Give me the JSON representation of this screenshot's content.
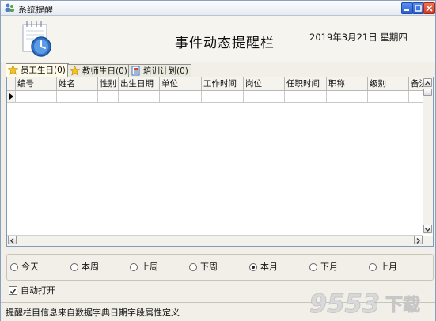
{
  "window": {
    "title": "系统提醒"
  },
  "header": {
    "title": "事件动态提醒栏",
    "date": "2019年3月21日  星期四"
  },
  "tabs": [
    {
      "label": "员工生日(0)",
      "icon": "star-icon"
    },
    {
      "label": "教师生日(0)",
      "icon": "star-icon"
    },
    {
      "label": "培训计划(0)",
      "icon": "document-icon"
    }
  ],
  "grid": {
    "columns": [
      "编号",
      "姓名",
      "性别",
      "出生日期",
      "单位",
      "工作时间",
      "岗位",
      "任职时间",
      "职称",
      "级别",
      "备注"
    ],
    "rows": []
  },
  "filter": {
    "options": [
      "今天",
      "本周",
      "上周",
      "下周",
      "本月",
      "下月",
      "上月"
    ],
    "selected": "本月"
  },
  "auto_open": {
    "label": "自动打开",
    "checked": true
  },
  "status": {
    "text": "提醒栏目信息来自数据字典日期字段属性定义"
  },
  "watermark": {
    "text": "9553下载"
  },
  "colors": {
    "titlebar": "#e6eaf1",
    "close_button": "#d03a1e",
    "grid_border": "#7f9db9",
    "watermark": "#d9d9d9"
  }
}
